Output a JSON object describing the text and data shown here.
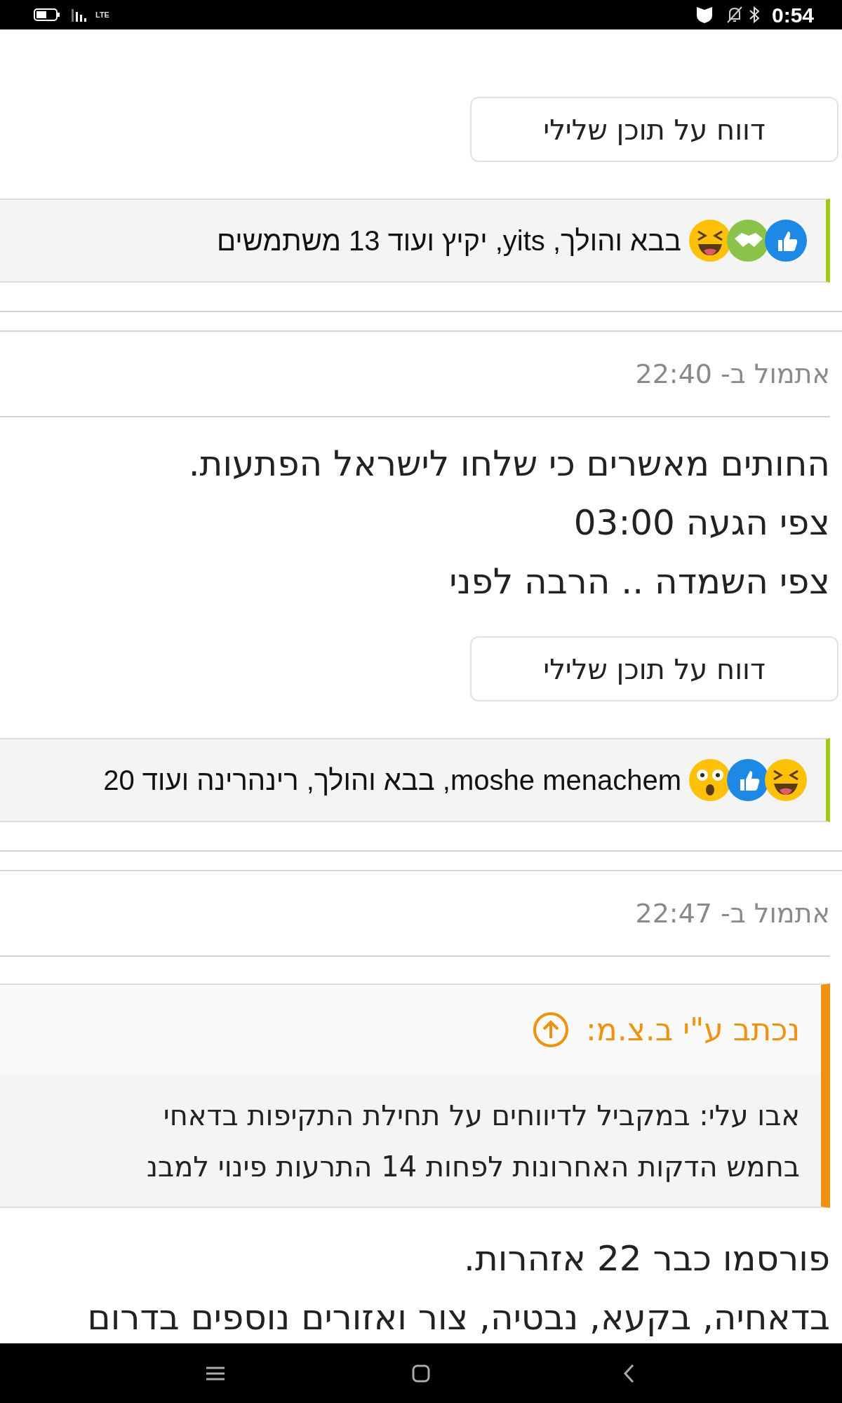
{
  "status_bar": {
    "network": "LTE",
    "time": "0:54"
  },
  "posts": [
    {
      "kind": "tail",
      "report_button": "דווח על תוכן שלילי",
      "reactions": {
        "icons": [
          {
            "kind": "like"
          },
          {
            "kind": "agree"
          },
          {
            "kind": "haha"
          }
        ],
        "text": "בבא והולך, yits, יקיץ ועוד 13 משתמשים"
      }
    },
    {
      "kind": "post",
      "time": "אתמול ב- 22:40",
      "lines": [
        "החותים מאשרים כי שלחו לישראל הפתעות.",
        "צפי הגעה 03:00",
        "צפי השמדה .. הרבה לפני"
      ],
      "report_button": "דווח על תוכן שלילי",
      "reactions": {
        "icons": [
          {
            "kind": "haha"
          },
          {
            "kind": "like"
          },
          {
            "kind": "wow"
          }
        ],
        "text": "moshe menachem, בבא והולך, רינהרינה ועוד 20"
      }
    },
    {
      "kind": "post",
      "time": "אתמול ב- 22:47",
      "quote": {
        "header": "נכתב ע\"י ב.צ.מ:",
        "lines": [
          "אבו עלי: במקביל לדיווחים על תחילת התקיפות בדאחי",
          "בחמש הדקות האחרונות לפחות 14 התרעות פינוי למבנ"
        ]
      },
      "lines": [
        "פורסמו כבר 22 אזהרות.",
        "בדאחיה, בקעא, נבטיה, צור ואזורים נוספים בדרום"
      ]
    }
  ]
}
